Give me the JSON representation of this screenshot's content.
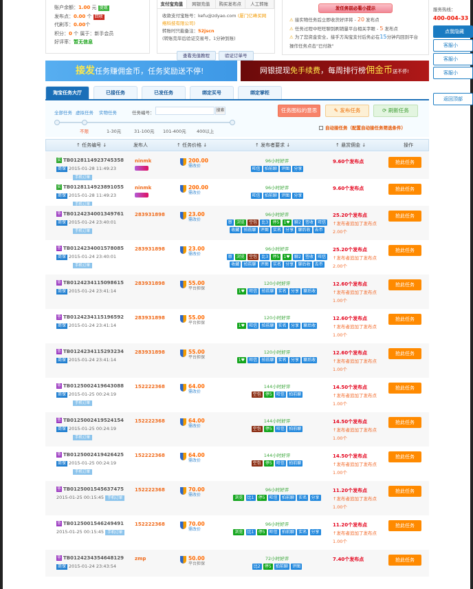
{
  "account": {
    "balance_label": "账户余额：",
    "balance": "1.00",
    "balance_unit": "元",
    "withdraw": "提现",
    "points_label": "发布点：",
    "points": "0.00",
    "points_unit": "个",
    "recycle": "回收",
    "coins_label": "代刷币：",
    "coins": "0.00",
    "coins_unit": "个",
    "score_label": "积分：",
    "score": "0",
    "score_rest": "个 属于：新手会员",
    "rating_label": "好评率：",
    "rating": "暂无信息"
  },
  "pay": {
    "tabs": [
      "支付宝充值",
      "网银充值",
      "购买发布点",
      "人工转账"
    ],
    "line1": "收款支付宝账号：kefu@zdyao.com",
    "company": "(厦门亿峰买网络科技有限公司)",
    "line2": "转账时只能备注：",
    "memo": "52jscn",
    "line3": "(转账完毕后验证交易号，1分钟到账)",
    "btn_tutorial": "查看充值教程",
    "btn_verify": "验证订单号"
  },
  "notice": {
    "title": "发任务前必看小提示",
    "items": [
      {
        "text": "接实物任务后立即收货好评将 - ",
        "num": "20",
        "unit": " 发布点"
      },
      {
        "text": "任务过程中旺旺聊到刷销量平台相关字眼 - ",
        "num": "5",
        "unit": " 发布点"
      },
      {
        "text": "为了您资金安全，接手方淘宝支付后务必在",
        "num": "15",
        "unit": "分钟内回到平台操作任务点击\"已付款\""
      }
    ]
  },
  "side": {
    "hotline_label": "服务热线：",
    "hotline": "400-004-33",
    "hide_btn": "点我隐藏",
    "kefu": [
      "客服小",
      "客服小",
      "客服小"
    ],
    "back_top": "返回顶部"
  },
  "banners": {
    "left_em": "接发",
    "left": "任务赚佣金币，任务奖励送不停!",
    "right_a": "网银提现",
    "right_em": "免手续费",
    "right_b": "，每周排行榜",
    "right_c": "佣金币",
    "right_d": "送不停!"
  },
  "tabs": [
    "淘宝任务大厅",
    "已接任务",
    "已发任务",
    "绑定买号",
    "绑定掌柜"
  ],
  "filter": {
    "links": [
      "全部任务",
      "虚拟任务",
      "实物任务"
    ],
    "id_label": "任务编号：",
    "search_value": "",
    "search": "搜索",
    "ranges": [
      "不限",
      "1-30元",
      "31-100元",
      "101-400元",
      "400以上"
    ],
    "legend": "任务图标的意思",
    "publish": "发布任务",
    "refresh": "刷新任务",
    "auto": "自动接任务（配置自动接任务筛选条件）"
  },
  "colors": {
    "orange": "#ff8a00",
    "blue": "#1a6fb8",
    "red": "#e4001a",
    "green": "#12a51c"
  },
  "table": {
    "headers": [
      "↑ 任务编号 ↓",
      "发布人",
      "↑ 任务价格 ↓",
      "↑ 发布者要求 ↓",
      "↑ 悬赏佣金 ↓",
      "操作"
    ],
    "rows": [
      {
        "badge": "实",
        "id": "TB0128114923745358",
        "sb": "商保",
        "date": "2015-01-28 11:49:23",
        "mobile": "手机订单",
        "pub": "ninmk",
        "vip": true,
        "price": "200.00",
        "ptype": "需改价",
        "req": "96小时好评",
        "tags": [
          [
            "旺信",
            "b"
          ],
          [
            "拍前聊",
            "b"
          ],
          [
            "评图",
            "b"
          ],
          [
            "分享",
            "b"
          ]
        ],
        "reward": "9.60个发布点",
        "btn": "抢此任务"
      },
      {
        "badge": "实",
        "id": "TB0128114923891055",
        "sb": "商保",
        "date": "2015-01-28 11:49:23",
        "mobile": "手机订单",
        "pub": "ninmk",
        "vip": true,
        "price": "200.00",
        "ptype": "需改价",
        "req": "96小时好评",
        "tags": [
          [
            "旺信",
            "b"
          ],
          [
            "拍前聊",
            "b"
          ],
          [
            "评图",
            "b"
          ],
          [
            "分享",
            "b"
          ]
        ],
        "reward": "9.60个发布点",
        "btn": "抢此任务"
      },
      {
        "badge": "垫",
        "id": "TB0124234001349761",
        "sb": "商保",
        "date": "2015-01-24 23:40:01",
        "mobile": "手机订单",
        "pub": "283931898",
        "price": "23.00",
        "ptype": "需改价",
        "req": "96小时好评",
        "tags": [
          [
            "审",
            "b"
          ],
          [
            "浏览",
            "g"
          ],
          [
            "空包",
            "r"
          ],
          [
            "比3",
            "b"
          ],
          [
            "停5",
            "g"
          ],
          [
            "1♥",
            "g"
          ],
          [
            "聊2",
            "b"
          ],
          [
            "签收",
            "b"
          ],
          [
            "旺信",
            "b"
          ],
          [
            "收藏",
            "b"
          ],
          [
            "拍前聊",
            "b"
          ],
          [
            "评图",
            "b"
          ],
          [
            "实名",
            "b"
          ],
          [
            "分享",
            "b"
          ],
          [
            "聊后收",
            "b"
          ],
          [
            "去币",
            "b"
          ]
        ],
        "reward": "25.20个发布点",
        "add": "↑发布者追加了发布点",
        "addv": "2.00个",
        "btn": "抢此任务"
      },
      {
        "badge": "垫",
        "id": "TB0124234001578085",
        "sb": "商保",
        "date": "2015-01-24 23:40:01",
        "mobile": "手机订单",
        "pub": "283931898",
        "price": "23.00",
        "ptype": "需改价",
        "req": "96小时好评",
        "tags": [
          [
            "审",
            "b"
          ],
          [
            "浏览",
            "g"
          ],
          [
            "空包",
            "r"
          ],
          [
            "比3",
            "b"
          ],
          [
            "停5",
            "g"
          ],
          [
            "1♥",
            "g"
          ],
          [
            "聊2",
            "b"
          ],
          [
            "签收",
            "b"
          ],
          [
            "旺信",
            "b"
          ],
          [
            "收藏",
            "b"
          ],
          [
            "拍前聊",
            "b"
          ],
          [
            "评图",
            "b"
          ],
          [
            "实名",
            "b"
          ],
          [
            "分享",
            "b"
          ],
          [
            "聊后收",
            "b"
          ],
          [
            "去币",
            "b"
          ]
        ],
        "reward": "25.20个发布点",
        "add": "↑发布者追加了发布点",
        "addv": "2.00个",
        "btn": "抢此任务"
      },
      {
        "badge": "垫",
        "id": "TB0124234115098615",
        "sb": "商保",
        "date": "2015-01-24 23:41:14",
        "pub": "283931898",
        "price": "55.00",
        "ptype": "平台担保",
        "req": "120小时好评",
        "tags": [
          [
            "1♥",
            "g"
          ],
          [
            "旺信",
            "b"
          ],
          [
            "拍前聊",
            "b"
          ],
          [
            "实名",
            "b"
          ],
          [
            "分享",
            "b"
          ],
          [
            "聊后收",
            "b"
          ]
        ],
        "reward": "12.60个发布点",
        "add": "↑发布者追加了发布点",
        "addv": "1.00个",
        "btn": "抢此任务"
      },
      {
        "badge": "垫",
        "id": "TB0124234115196592",
        "sb": "商保",
        "date": "2015-01-24 23:41:14",
        "pub": "283931898",
        "price": "55.00",
        "ptype": "平台担保",
        "req": "120小时好评",
        "tags": [
          [
            "1♥",
            "g"
          ],
          [
            "旺信",
            "b"
          ],
          [
            "拍前聊",
            "b"
          ],
          [
            "实名",
            "b"
          ],
          [
            "分享",
            "b"
          ],
          [
            "聊后收",
            "b"
          ]
        ],
        "reward": "12.60个发布点",
        "add": "↑发布者追加了发布点",
        "addv": "1.00个",
        "btn": "抢此任务"
      },
      {
        "badge": "垫",
        "id": "TB0124234115293234",
        "sb": "商保",
        "date": "2015-01-24 23:41:14",
        "pub": "283931898",
        "price": "55.00",
        "ptype": "平台担保",
        "req": "120小时好评",
        "tags": [
          [
            "1♥",
            "g"
          ],
          [
            "旺信",
            "b"
          ],
          [
            "拍前聊",
            "b"
          ],
          [
            "实名",
            "b"
          ],
          [
            "分享",
            "b"
          ],
          [
            "聊后收",
            "b"
          ]
        ],
        "reward": "12.60个发布点",
        "add": "↑发布者追加了发布点",
        "addv": "1.00个",
        "btn": "抢此任务"
      },
      {
        "badge": "垫",
        "id": "TB0125002419643088",
        "sb": "商保",
        "date": "2015-01-25 00:24:19",
        "mobile": "手机订单",
        "pub": "152222368",
        "price": "64.00",
        "ptype": "需改价",
        "req": "144小时好评",
        "tags": [
          [
            "空包",
            "r"
          ],
          [
            "停5",
            "g"
          ],
          [
            "旺信",
            "b"
          ],
          [
            "拍前聊",
            "b"
          ]
        ],
        "reward": "14.50个发布点",
        "add": "↑发布者追加了发布点",
        "addv": "1.00个",
        "btn": "抢此任务"
      },
      {
        "badge": "垫",
        "id": "TB0125002419524154",
        "sb": "商保",
        "date": "2015-01-25 00:24:19",
        "mobile": "手机订单",
        "pub": "152222368",
        "price": "64.00",
        "ptype": "需改价",
        "req": "144小时好评",
        "tags": [
          [
            "空包",
            "r"
          ],
          [
            "停5",
            "g"
          ],
          [
            "旺信",
            "b"
          ],
          [
            "拍前聊",
            "b"
          ]
        ],
        "reward": "14.50个发布点",
        "add": "↑发布者追加了发布点",
        "addv": "1.00个",
        "btn": "抢此任务"
      },
      {
        "badge": "垫",
        "id": "TB0125002419426425",
        "sb": "商保",
        "date": "2015-01-25 00:24:19",
        "mobile": "手机订单",
        "pub": "152222368",
        "price": "64.00",
        "ptype": "需改价",
        "req": "144小时好评",
        "tags": [
          [
            "空包",
            "r"
          ],
          [
            "停5",
            "g"
          ],
          [
            "旺信",
            "b"
          ],
          [
            "拍前聊",
            "b"
          ]
        ],
        "reward": "14.50个发布点",
        "add": "↑发布者追加了发布点",
        "addv": "1.00个",
        "btn": "抢此任务"
      },
      {
        "badge": "垫",
        "id": "TB0125001545637475",
        "date": "2015-01-25 00:15:45",
        "mobile_inline": "手机订单",
        "pub": "152222368",
        "price": "70.00",
        "ptype": "需改价",
        "req": "96小时好评",
        "tags": [
          [
            "浏览",
            "g"
          ],
          [
            "比1",
            "b"
          ],
          [
            "停5",
            "g"
          ],
          [
            "旺信",
            "b"
          ],
          [
            "拍前聊",
            "b"
          ],
          [
            "实名",
            "b"
          ],
          [
            "分享",
            "b"
          ]
        ],
        "reward": "11.20个发布点",
        "add": "↑发布者追加了发布点",
        "addv": "1.00个",
        "btn": "抢此任务"
      },
      {
        "badge": "垫",
        "id": "TB0125001546249491",
        "date": "2015-01-25 00:15:45",
        "mobile_inline": "手机订单",
        "pub": "152222368",
        "price": "70.00",
        "ptype": "需改价",
        "req": "96小时好评",
        "tags": [
          [
            "浏览",
            "g"
          ],
          [
            "比1",
            "b"
          ],
          [
            "停5",
            "g"
          ],
          [
            "旺信",
            "b"
          ],
          [
            "拍前聊",
            "b"
          ],
          [
            "实名",
            "b"
          ],
          [
            "分享",
            "b"
          ]
        ],
        "reward": "11.20个发布点",
        "add": "↑发布者追加了发布点",
        "addv": "1.00个",
        "btn": "抢此任务"
      },
      {
        "badge": "垫",
        "id": "TB0124234354648129",
        "sb": "商保",
        "date": "2015-01-24 23:43:54",
        "pub": "zmp",
        "price": "50.00",
        "ptype": "平台担保",
        "req": "72小时好评",
        "tags": [
          [
            "比2",
            "b"
          ],
          [
            "停5",
            "g"
          ],
          [
            "拍前聊",
            "b"
          ],
          [
            "评图",
            "b"
          ]
        ],
        "reward": "7.40个发布点",
        "btn": "抢此任务"
      }
    ]
  }
}
